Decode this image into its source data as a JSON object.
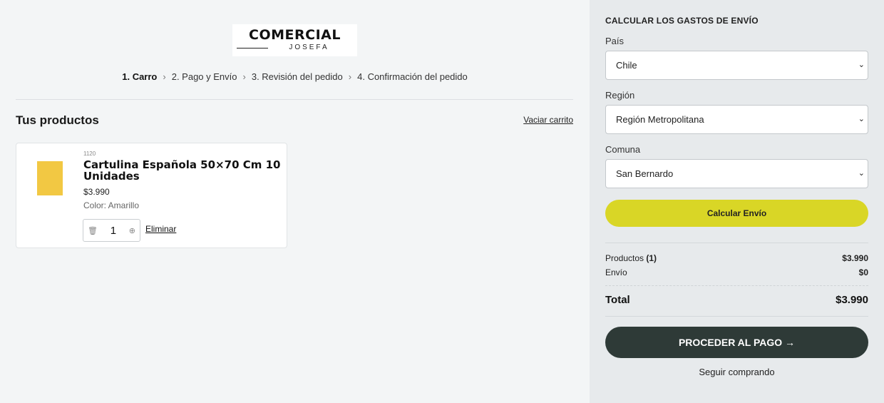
{
  "header": {
    "logo_top": "COMERCIAL",
    "logo_bottom": "JOSEFA",
    "steps": [
      {
        "label": "1. Carro"
      },
      {
        "label": "2. Pago y Envío"
      },
      {
        "label": "3. Revisión del pedido"
      },
      {
        "label": "4. Confirmación del pedido"
      }
    ]
  },
  "cart": {
    "title": "Tus productos",
    "empty_link": "Vaciar carrito",
    "items": [
      {
        "sku": "1120",
        "name": "Cartulina Española 50×70 Cm 10 Unidades",
        "price": "$3.990",
        "variant": "Color: Amarillo",
        "quantity": "1",
        "remove_label": "Eliminar",
        "swatch_color": "#f2c843"
      }
    ]
  },
  "shipping": {
    "title": "CALCULAR LOS GASTOS DE ENVÍO",
    "country_label": "País",
    "country_value": "Chile",
    "region_label": "Región",
    "region_value": "Región Metropolitana",
    "commune_label": "Comuna",
    "commune_value": "San Bernardo",
    "calc_button": "Calcular Envío",
    "calc_color": "#d9d626"
  },
  "summary": {
    "products_label": "Productos",
    "products_count": "(1)",
    "products_value": "$3.990",
    "shipping_label": "Envío",
    "shipping_value": "$0",
    "total_label": "Total",
    "total_value": "$3.990",
    "pay_button": "PROCEDER AL PAGO →",
    "pay_color": "#2e3a37",
    "continue_label": "Seguir comprando"
  },
  "icons": {
    "step_separator": "chevron-right-icon",
    "select_arrow": "chevron-down-icon",
    "stepper_left": "trash-icon",
    "stepper_right": "plus-circle-icon"
  }
}
